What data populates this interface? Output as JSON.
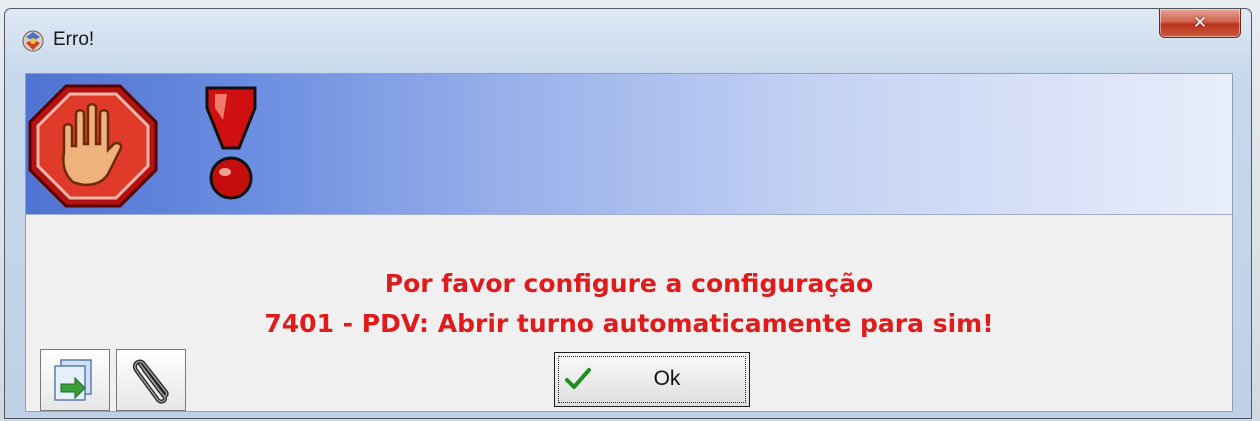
{
  "window": {
    "title": "Erro!",
    "close_label": "✕"
  },
  "message": {
    "line1": "Por favor configure a configuração",
    "line2": "7401 - PDV: Abrir turno automaticamente para sim!"
  },
  "buttons": {
    "ok_label": "Ok"
  },
  "icons": {
    "title": "error-app-icon",
    "stop": "stop-hand-icon",
    "exclamation": "exclamation-icon",
    "export": "export-document-icon",
    "attach": "paperclip-icon",
    "check": "checkmark-icon"
  },
  "colors": {
    "message_text": "#e01b1b",
    "banner_start": "#4f73d0",
    "banner_end": "#e9eefb",
    "close_button": "#c14a33"
  }
}
